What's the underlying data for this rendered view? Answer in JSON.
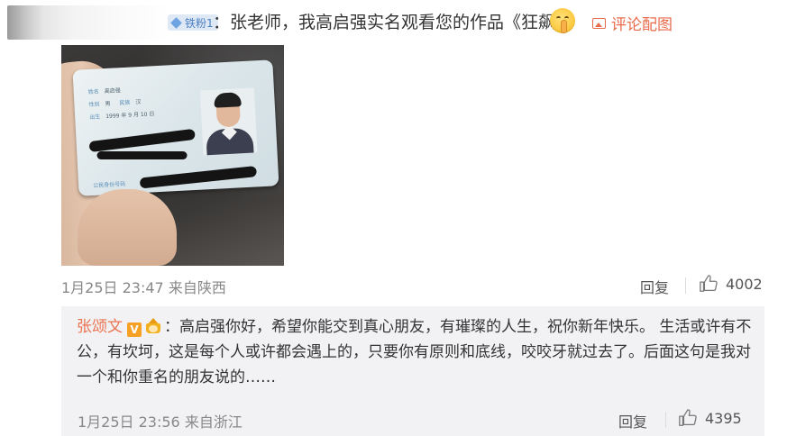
{
  "comment": {
    "fan_badge": "铁粉1",
    "text": "：张老师，我高启强实名观看您的作品《狂飙》",
    "emoji_icon": "shushing-face-icon",
    "pic_link_label": "评论配图",
    "pic_link_icon": "image-icon"
  },
  "photo": {
    "description_icon": "id-card-photo",
    "card": {
      "name_label": "姓名",
      "name_value": "高启强",
      "sex_label": "性别",
      "sex_value": "男",
      "ethnic_label": "民族",
      "ethnic_value": "汉",
      "birth_label": "出生",
      "birth_value": "1999 年 9 月 10 日",
      "id_label": "公民身份号码"
    }
  },
  "comment_meta": {
    "time_location": "1月25日 23:47 来自陕西",
    "reply_label": "回复",
    "like_icon": "thumbs-up-icon",
    "like_count": "4002"
  },
  "reply": {
    "author": "张颂文",
    "verified_badge": "V",
    "fan_icon": "crown-fan-badge-icon",
    "text": "：高启强你好，希望你能交到真心朋友，有璀璨的人生，祝你新年快乐。 生活或许有不公，有坎坷，这是每个人或许都会遇上的，只要你有原则和底线，咬咬牙就过去了。后面这句是我对一个和你重名的朋友说的……",
    "time_location": "1月25日 23:56 来自浙江",
    "reply_label": "回复",
    "like_icon": "thumbs-up-icon",
    "like_count": "4395"
  },
  "colors": {
    "accent": "#eb7350",
    "meta_text": "#888888",
    "reply_bg": "#f2f2f5",
    "fan_badge_bg": "#dfe9f6"
  }
}
